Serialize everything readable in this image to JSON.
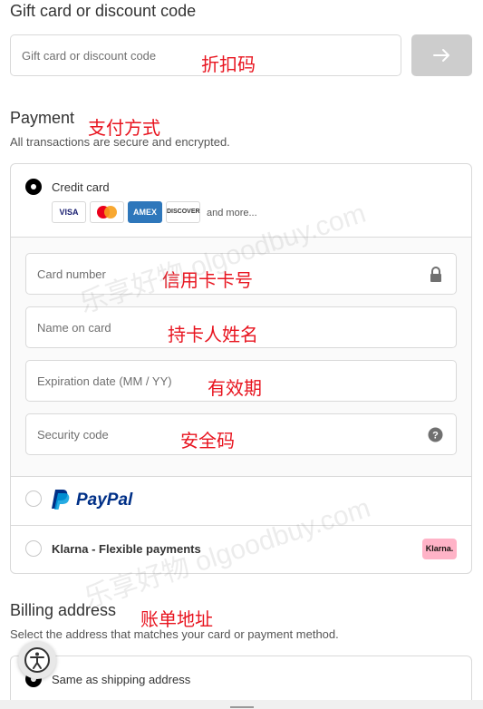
{
  "discount": {
    "heading": "Gift card or discount code",
    "placeholder": "Gift card or discount code",
    "annotation": "折扣码"
  },
  "payment": {
    "heading": "Payment",
    "annotation": "支付方式",
    "subtitle": "All transactions are secure and encrypted.",
    "credit_card_label": "Credit card",
    "card_logos": [
      "VISA",
      "MasterCard",
      "AMEX",
      "DISCOVER"
    ],
    "and_more": "and more...",
    "fields": {
      "card_number": {
        "placeholder": "Card number",
        "annotation": "信用卡卡号"
      },
      "name_on_card": {
        "placeholder": "Name on card",
        "annotation": "持卡人姓名"
      },
      "expiration": {
        "placeholder": "Expiration date (MM / YY)",
        "annotation": "有效期"
      },
      "security_code": {
        "placeholder": "Security code",
        "annotation": "安全码"
      }
    },
    "paypal_label": "PayPal",
    "klarna_label": "Klarna - Flexible payments",
    "klarna_badge": "Klarna."
  },
  "billing": {
    "heading": "Billing address",
    "annotation": "账单地址",
    "subtitle": "Select the address that matches your card or payment method.",
    "same_as_shipping": "Same as shipping address"
  },
  "watermark": "乐享好物 olgoodbuy.com",
  "colors": {
    "accent": "#e8141f",
    "paypal_dark": "#003087",
    "paypal_light": "#009cde",
    "klarna_pink": "#ffb3c7"
  }
}
